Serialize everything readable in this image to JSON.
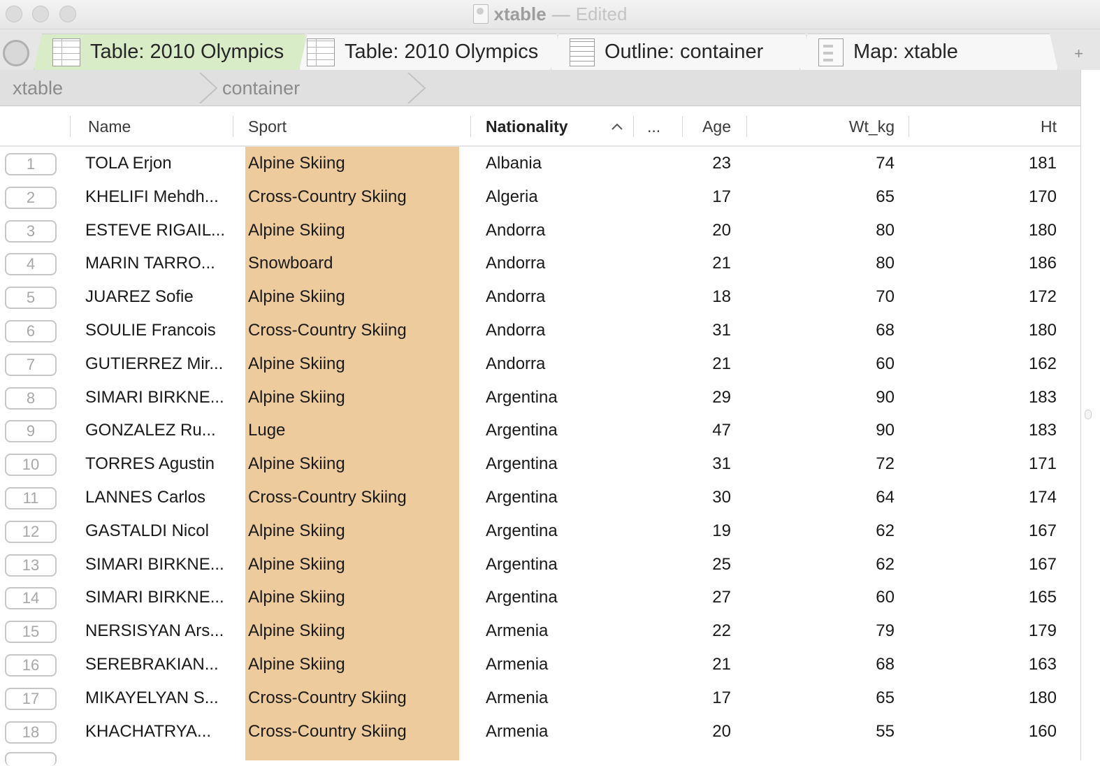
{
  "window": {
    "title": "xtable",
    "separator": "—",
    "status": "Edited"
  },
  "tabs": [
    {
      "label": "Table: 2010 Olympics",
      "icon": "table-icon",
      "active": true
    },
    {
      "label": "Table: 2010 Olympics",
      "icon": "table-icon",
      "active": false
    },
    {
      "label": "Outline: container",
      "icon": "outline-icon",
      "active": false
    },
    {
      "label": "Map: xtable",
      "icon": "map-icon",
      "active": false
    }
  ],
  "tab_add_label": "+",
  "breadcrumb": [
    "xtable",
    "container"
  ],
  "columns": {
    "name": "Name",
    "sport": "Sport",
    "nationality": "Nationality",
    "more": "...",
    "age": "Age",
    "weight": "Wt_kg",
    "height": "Ht"
  },
  "sort_indicator": "^",
  "colors": {
    "sport_highlight": "#eecb9d",
    "active_tab": "#d9ecc8"
  },
  "rows": [
    {
      "n": "1",
      "name": "TOLA Erjon",
      "sport": "Alpine Skiing",
      "nationality": "Albania",
      "age": "23",
      "wt": "74",
      "ht": "181"
    },
    {
      "n": "2",
      "name": "KHELIFI Mehdh...",
      "sport": "Cross-Country Skiing",
      "nationality": "Algeria",
      "age": "17",
      "wt": "65",
      "ht": "170"
    },
    {
      "n": "3",
      "name": "ESTEVE RIGAIL...",
      "sport": "Alpine Skiing",
      "nationality": "Andorra",
      "age": "20",
      "wt": "80",
      "ht": "180"
    },
    {
      "n": "4",
      "name": "MARIN TARRO...",
      "sport": "Snowboard",
      "nationality": "Andorra",
      "age": "21",
      "wt": "80",
      "ht": "186"
    },
    {
      "n": "5",
      "name": "JUAREZ Sofie",
      "sport": "Alpine Skiing",
      "nationality": "Andorra",
      "age": "18",
      "wt": "70",
      "ht": "172"
    },
    {
      "n": "6",
      "name": "SOULIE Francois",
      "sport": "Cross-Country Skiing",
      "nationality": "Andorra",
      "age": "31",
      "wt": "68",
      "ht": "180"
    },
    {
      "n": "7",
      "name": "GUTIERREZ Mir...",
      "sport": "Alpine Skiing",
      "nationality": "Andorra",
      "age": "21",
      "wt": "60",
      "ht": "162"
    },
    {
      "n": "8",
      "name": "SIMARI BIRKNE...",
      "sport": "Alpine Skiing",
      "nationality": "Argentina",
      "age": "29",
      "wt": "90",
      "ht": "183"
    },
    {
      "n": "9",
      "name": "GONZALEZ Ru...",
      "sport": "Luge",
      "nationality": "Argentina",
      "age": "47",
      "wt": "90",
      "ht": "183"
    },
    {
      "n": "10",
      "name": "TORRES Agustin",
      "sport": "Alpine Skiing",
      "nationality": "Argentina",
      "age": "31",
      "wt": "72",
      "ht": "171"
    },
    {
      "n": "11",
      "name": "LANNES Carlos",
      "sport": "Cross-Country Skiing",
      "nationality": "Argentina",
      "age": "30",
      "wt": "64",
      "ht": "174"
    },
    {
      "n": "12",
      "name": "GASTALDI Nicol",
      "sport": "Alpine Skiing",
      "nationality": "Argentina",
      "age": "19",
      "wt": "62",
      "ht": "167"
    },
    {
      "n": "13",
      "name": "SIMARI BIRKNE...",
      "sport": "Alpine Skiing",
      "nationality": "Argentina",
      "age": "25",
      "wt": "62",
      "ht": "167"
    },
    {
      "n": "14",
      "name": "SIMARI BIRKNE...",
      "sport": "Alpine Skiing",
      "nationality": "Argentina",
      "age": "27",
      "wt": "60",
      "ht": "165"
    },
    {
      "n": "15",
      "name": "NERSISYAN Ars...",
      "sport": "Alpine Skiing",
      "nationality": "Armenia",
      "age": "22",
      "wt": "79",
      "ht": "179"
    },
    {
      "n": "16",
      "name": "SEREBRAKIAN...",
      "sport": "Alpine Skiing",
      "nationality": "Armenia",
      "age": "21",
      "wt": "68",
      "ht": "163"
    },
    {
      "n": "17",
      "name": "MIKAYELYAN S...",
      "sport": "Cross-Country Skiing",
      "nationality": "Armenia",
      "age": "17",
      "wt": "65",
      "ht": "180"
    },
    {
      "n": "18",
      "name": "KHACHATRYA...",
      "sport": "Cross-Country Skiing",
      "nationality": "Armenia",
      "age": "20",
      "wt": "55",
      "ht": "160"
    }
  ]
}
